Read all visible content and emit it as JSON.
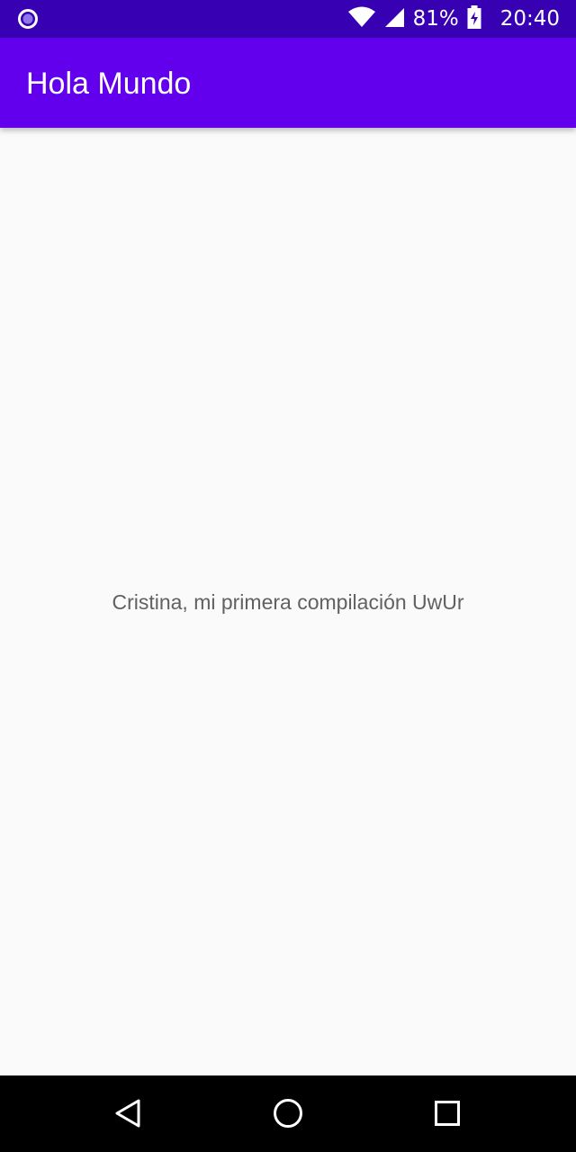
{
  "status_bar": {
    "notification_icon": "circle-notification-icon",
    "wifi_icon": "wifi-icon",
    "signal_icon": "cellular-signal-icon",
    "battery_percent": "81%",
    "battery_icon": "battery-charging-icon",
    "time": "20:40"
  },
  "app_bar": {
    "title": "Hola Mundo",
    "color": "#6200ee"
  },
  "content": {
    "message": "Cristina, mi primera compilación UwUr"
  },
  "nav_bar": {
    "back_icon": "back-triangle-icon",
    "home_icon": "home-circle-icon",
    "recents_icon": "recents-square-icon"
  },
  "colors": {
    "status_bar": "#3700b3",
    "primary": "#6200ee",
    "background": "#fafafa",
    "text": "#616161"
  }
}
